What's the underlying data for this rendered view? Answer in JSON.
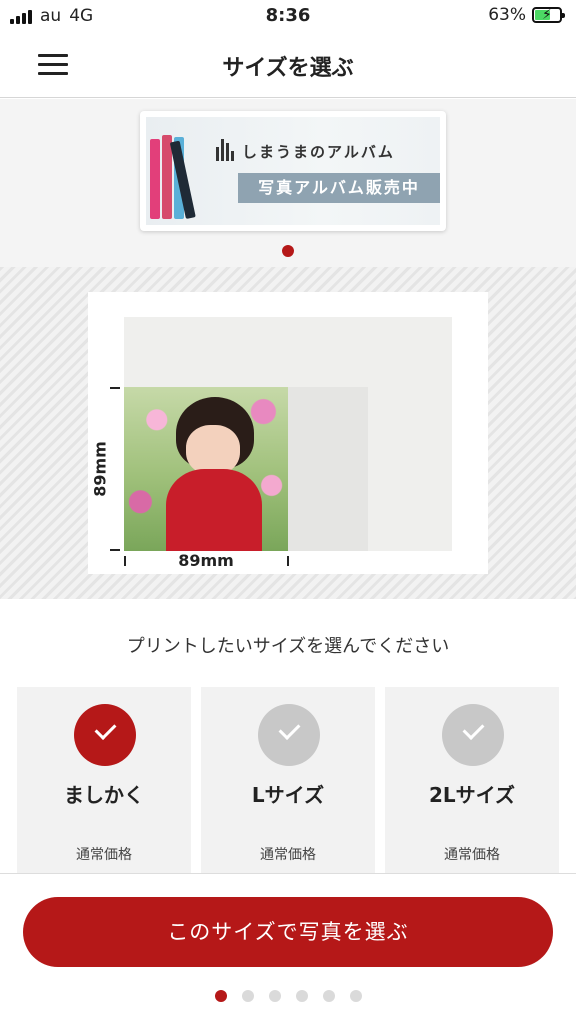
{
  "status_bar": {
    "carrier": "au",
    "network": "4G",
    "time": "8:36",
    "battery_percent": "63%",
    "battery_level": 0.63,
    "battery_charging": true,
    "battery_color": "#4cd964"
  },
  "nav": {
    "title": "サイズを選ぶ",
    "menu_icon": "hamburger-menu-icon"
  },
  "banner": {
    "title": "しまうまのアルバム",
    "subtitle": "写真アルバム販売中",
    "carousel_index": 1,
    "carousel_count": 1
  },
  "preview": {
    "width_label": "89mm",
    "height_label": "89mm"
  },
  "instruction": "プリントしたいサイズを選んでください",
  "size_options": [
    {
      "name": "ましかく",
      "price_label": "通常価格",
      "selected": true
    },
    {
      "name": "Lサイズ",
      "price_label": "通常価格",
      "selected": false
    },
    {
      "name": "2Lサイズ",
      "price_label": "通常価格",
      "selected": false
    }
  ],
  "cta": {
    "label": "このサイズで写真を選ぶ"
  },
  "pager": {
    "current": 1,
    "total": 6
  },
  "colors": {
    "accent": "#b51818",
    "unselected_check": "#c8c8c8",
    "card_background": "#f2f2f2"
  }
}
